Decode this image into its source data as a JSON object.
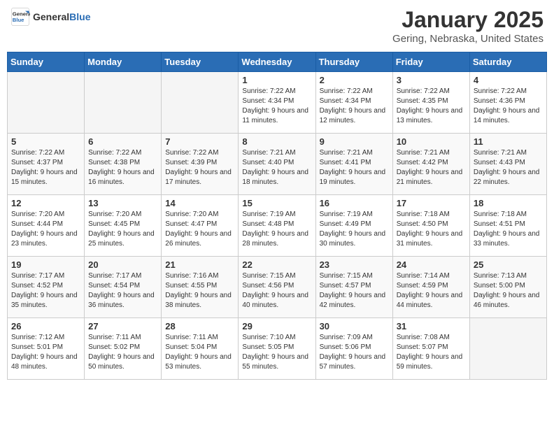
{
  "header": {
    "logo_general": "General",
    "logo_blue": "Blue",
    "month": "January 2025",
    "location": "Gering, Nebraska, United States"
  },
  "days_of_week": [
    "Sunday",
    "Monday",
    "Tuesday",
    "Wednesday",
    "Thursday",
    "Friday",
    "Saturday"
  ],
  "weeks": [
    [
      {
        "num": "",
        "empty": true
      },
      {
        "num": "",
        "empty": true
      },
      {
        "num": "",
        "empty": true
      },
      {
        "num": "1",
        "sunrise": "7:22 AM",
        "sunset": "4:34 PM",
        "daylight": "9 hours and 11 minutes."
      },
      {
        "num": "2",
        "sunrise": "7:22 AM",
        "sunset": "4:34 PM",
        "daylight": "9 hours and 12 minutes."
      },
      {
        "num": "3",
        "sunrise": "7:22 AM",
        "sunset": "4:35 PM",
        "daylight": "9 hours and 13 minutes."
      },
      {
        "num": "4",
        "sunrise": "7:22 AM",
        "sunset": "4:36 PM",
        "daylight": "9 hours and 14 minutes."
      }
    ],
    [
      {
        "num": "5",
        "sunrise": "7:22 AM",
        "sunset": "4:37 PM",
        "daylight": "9 hours and 15 minutes."
      },
      {
        "num": "6",
        "sunrise": "7:22 AM",
        "sunset": "4:38 PM",
        "daylight": "9 hours and 16 minutes."
      },
      {
        "num": "7",
        "sunrise": "7:22 AM",
        "sunset": "4:39 PM",
        "daylight": "9 hours and 17 minutes."
      },
      {
        "num": "8",
        "sunrise": "7:21 AM",
        "sunset": "4:40 PM",
        "daylight": "9 hours and 18 minutes."
      },
      {
        "num": "9",
        "sunrise": "7:21 AM",
        "sunset": "4:41 PM",
        "daylight": "9 hours and 19 minutes."
      },
      {
        "num": "10",
        "sunrise": "7:21 AM",
        "sunset": "4:42 PM",
        "daylight": "9 hours and 21 minutes."
      },
      {
        "num": "11",
        "sunrise": "7:21 AM",
        "sunset": "4:43 PM",
        "daylight": "9 hours and 22 minutes."
      }
    ],
    [
      {
        "num": "12",
        "sunrise": "7:20 AM",
        "sunset": "4:44 PM",
        "daylight": "9 hours and 23 minutes."
      },
      {
        "num": "13",
        "sunrise": "7:20 AM",
        "sunset": "4:45 PM",
        "daylight": "9 hours and 25 minutes."
      },
      {
        "num": "14",
        "sunrise": "7:20 AM",
        "sunset": "4:47 PM",
        "daylight": "9 hours and 26 minutes."
      },
      {
        "num": "15",
        "sunrise": "7:19 AM",
        "sunset": "4:48 PM",
        "daylight": "9 hours and 28 minutes."
      },
      {
        "num": "16",
        "sunrise": "7:19 AM",
        "sunset": "4:49 PM",
        "daylight": "9 hours and 30 minutes."
      },
      {
        "num": "17",
        "sunrise": "7:18 AM",
        "sunset": "4:50 PM",
        "daylight": "9 hours and 31 minutes."
      },
      {
        "num": "18",
        "sunrise": "7:18 AM",
        "sunset": "4:51 PM",
        "daylight": "9 hours and 33 minutes."
      }
    ],
    [
      {
        "num": "19",
        "sunrise": "7:17 AM",
        "sunset": "4:52 PM",
        "daylight": "9 hours and 35 minutes."
      },
      {
        "num": "20",
        "sunrise": "7:17 AM",
        "sunset": "4:54 PM",
        "daylight": "9 hours and 36 minutes."
      },
      {
        "num": "21",
        "sunrise": "7:16 AM",
        "sunset": "4:55 PM",
        "daylight": "9 hours and 38 minutes."
      },
      {
        "num": "22",
        "sunrise": "7:15 AM",
        "sunset": "4:56 PM",
        "daylight": "9 hours and 40 minutes."
      },
      {
        "num": "23",
        "sunrise": "7:15 AM",
        "sunset": "4:57 PM",
        "daylight": "9 hours and 42 minutes."
      },
      {
        "num": "24",
        "sunrise": "7:14 AM",
        "sunset": "4:59 PM",
        "daylight": "9 hours and 44 minutes."
      },
      {
        "num": "25",
        "sunrise": "7:13 AM",
        "sunset": "5:00 PM",
        "daylight": "9 hours and 46 minutes."
      }
    ],
    [
      {
        "num": "26",
        "sunrise": "7:12 AM",
        "sunset": "5:01 PM",
        "daylight": "9 hours and 48 minutes."
      },
      {
        "num": "27",
        "sunrise": "7:11 AM",
        "sunset": "5:02 PM",
        "daylight": "9 hours and 50 minutes."
      },
      {
        "num": "28",
        "sunrise": "7:11 AM",
        "sunset": "5:04 PM",
        "daylight": "9 hours and 53 minutes."
      },
      {
        "num": "29",
        "sunrise": "7:10 AM",
        "sunset": "5:05 PM",
        "daylight": "9 hours and 55 minutes."
      },
      {
        "num": "30",
        "sunrise": "7:09 AM",
        "sunset": "5:06 PM",
        "daylight": "9 hours and 57 minutes."
      },
      {
        "num": "31",
        "sunrise": "7:08 AM",
        "sunset": "5:07 PM",
        "daylight": "9 hours and 59 minutes."
      },
      {
        "num": "",
        "empty": true
      }
    ]
  ],
  "labels": {
    "sunrise_prefix": "Sunrise: ",
    "sunset_prefix": "Sunset: ",
    "daylight_prefix": "Daylight: "
  }
}
